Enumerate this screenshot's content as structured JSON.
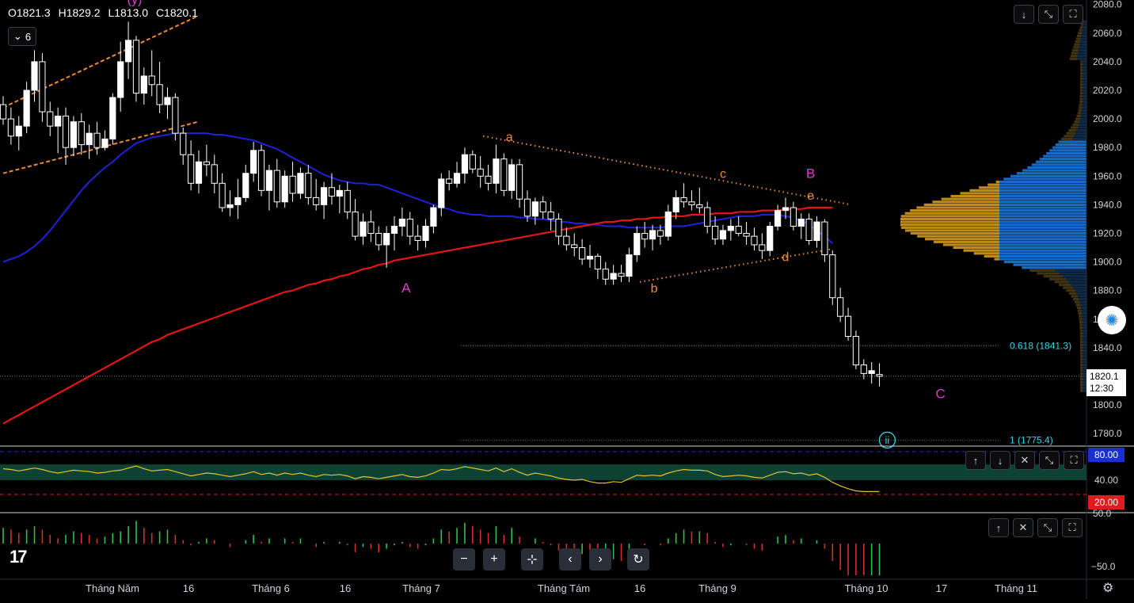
{
  "legend": {
    "open": "O1821.3",
    "high": "H1829.2",
    "low": "L1813.0",
    "close": "C1820.1",
    "indicator_count": "6"
  },
  "colors": {
    "background": "#000000",
    "candle_up": "#ffffff",
    "candle_down": "#ffffff",
    "ma_short": "#1f22d8",
    "ma_long": "#e31515",
    "channel": "#f08a35",
    "wave_orange": "#f08a35",
    "wave_magenta": "#e23bd0",
    "fib": "#39d3e8",
    "rsi_line": "#e6c229",
    "rsi_band": "#0f4a3a",
    "profile_gold": "#c8921e",
    "profile_blue": "#1a6fd0",
    "hist_green": "#2fbf4a",
    "hist_red": "#d42f2f",
    "rsi_80": "#1a2fcf",
    "rsi_20": "#e01b1b"
  },
  "price_axis": {
    "labels": [
      "2080.0",
      "2060.0",
      "2040.0",
      "2020.0",
      "2000.0",
      "1980.0",
      "1960.0",
      "1940.0",
      "1920.0",
      "1900.0",
      "1880.0",
      "1840.0",
      "1820.0",
      "1800.0",
      "1780.0"
    ],
    "partial_label": "1"
  },
  "current_price": {
    "price": "1820.1",
    "countdown": "12:30"
  },
  "fib_levels": [
    {
      "label": "0.618 (1841.3)",
      "value": 1841.3
    },
    {
      "label": "1 (1775.4)",
      "value": 1775.4
    }
  ],
  "wave_labels": [
    {
      "text": "(y)",
      "color": "#e23bd0"
    },
    {
      "text": "A",
      "color": "#e23bd0"
    },
    {
      "text": "a",
      "color": "#f08a35"
    },
    {
      "text": "b",
      "color": "#f08a35"
    },
    {
      "text": "c",
      "color": "#f08a35"
    },
    {
      "text": "d",
      "color": "#f08a35"
    },
    {
      "text": "e",
      "color": "#f08a35"
    },
    {
      "text": "B",
      "color": "#e23bd0"
    },
    {
      "text": "C",
      "color": "#e23bd0"
    },
    {
      "text": "ii",
      "color": "#39d3e8"
    }
  ],
  "rsi_axis": {
    "upper": "80.00",
    "mid": "40.00",
    "lower": "20.00"
  },
  "hist_axis": {
    "upper": "50.0",
    "lower": "−50.0"
  },
  "time_axis": [
    "Tháng Năm",
    "16",
    "Tháng 6",
    "16",
    "Tháng 7",
    "Tháng Tám",
    "16",
    "Tháng 9",
    "Tháng 10",
    "17",
    "Tháng 11"
  ],
  "chart_data": {
    "type": "candlestick",
    "title": "",
    "ylim": [
      1770,
      2082
    ],
    "rsi_levels": [
      80,
      20
    ],
    "candles": [
      {
        "o": 2010,
        "h": 2016,
        "l": 1996,
        "c": 2000
      },
      {
        "o": 2000,
        "h": 2008,
        "l": 1982,
        "c": 1988
      },
      {
        "o": 1988,
        "h": 2002,
        "l": 1978,
        "c": 1995
      },
      {
        "o": 1995,
        "h": 2026,
        "l": 1990,
        "c": 2020
      },
      {
        "o": 2020,
        "h": 2048,
        "l": 2012,
        "c": 2040
      },
      {
        "o": 2040,
        "h": 2046,
        "l": 1998,
        "c": 2005
      },
      {
        "o": 2005,
        "h": 2012,
        "l": 1988,
        "c": 1995
      },
      {
        "o": 1995,
        "h": 2008,
        "l": 1976,
        "c": 2002
      },
      {
        "o": 2002,
        "h": 2008,
        "l": 1968,
        "c": 1980
      },
      {
        "o": 1980,
        "h": 2002,
        "l": 1974,
        "c": 1998
      },
      {
        "o": 1998,
        "h": 2004,
        "l": 1975,
        "c": 1982
      },
      {
        "o": 1982,
        "h": 1996,
        "l": 1972,
        "c": 1990
      },
      {
        "o": 1990,
        "h": 1998,
        "l": 1975,
        "c": 1980
      },
      {
        "o": 1980,
        "h": 1992,
        "l": 1978,
        "c": 1986
      },
      {
        "o": 1986,
        "h": 2018,
        "l": 1982,
        "c": 2015
      },
      {
        "o": 2015,
        "h": 2054,
        "l": 2005,
        "c": 2040
      },
      {
        "o": 2040,
        "h": 2068,
        "l": 2028,
        "c": 2055
      },
      {
        "o": 2055,
        "h": 2058,
        "l": 2012,
        "c": 2018
      },
      {
        "o": 2018,
        "h": 2036,
        "l": 2010,
        "c": 2030
      },
      {
        "o": 2030,
        "h": 2048,
        "l": 2016,
        "c": 2024
      },
      {
        "o": 2024,
        "h": 2040,
        "l": 2004,
        "c": 2010
      },
      {
        "o": 2010,
        "h": 2022,
        "l": 2000,
        "c": 2015
      },
      {
        "o": 2015,
        "h": 2018,
        "l": 1985,
        "c": 1990
      },
      {
        "o": 1990,
        "h": 1994,
        "l": 1968,
        "c": 1975
      },
      {
        "o": 1975,
        "h": 1985,
        "l": 1950,
        "c": 1955
      },
      {
        "o": 1955,
        "h": 1978,
        "l": 1948,
        "c": 1970
      },
      {
        "o": 1970,
        "h": 1982,
        "l": 1960,
        "c": 1968
      },
      {
        "o": 1968,
        "h": 1975,
        "l": 1948,
        "c": 1955
      },
      {
        "o": 1955,
        "h": 1962,
        "l": 1935,
        "c": 1938
      },
      {
        "o": 1938,
        "h": 1950,
        "l": 1932,
        "c": 1940
      },
      {
        "o": 1940,
        "h": 1958,
        "l": 1930,
        "c": 1945
      },
      {
        "o": 1945,
        "h": 1968,
        "l": 1942,
        "c": 1962
      },
      {
        "o": 1962,
        "h": 1984,
        "l": 1956,
        "c": 1978
      },
      {
        "o": 1978,
        "h": 1982,
        "l": 1946,
        "c": 1950
      },
      {
        "o": 1950,
        "h": 1968,
        "l": 1936,
        "c": 1964
      },
      {
        "o": 1964,
        "h": 1972,
        "l": 1938,
        "c": 1942
      },
      {
        "o": 1942,
        "h": 1964,
        "l": 1938,
        "c": 1960
      },
      {
        "o": 1960,
        "h": 1970,
        "l": 1942,
        "c": 1948
      },
      {
        "o": 1948,
        "h": 1966,
        "l": 1944,
        "c": 1962
      },
      {
        "o": 1962,
        "h": 1968,
        "l": 1940,
        "c": 1945
      },
      {
        "o": 1945,
        "h": 1958,
        "l": 1936,
        "c": 1940
      },
      {
        "o": 1940,
        "h": 1956,
        "l": 1930,
        "c": 1952
      },
      {
        "o": 1952,
        "h": 1962,
        "l": 1940,
        "c": 1946
      },
      {
        "o": 1946,
        "h": 1954,
        "l": 1934,
        "c": 1950
      },
      {
        "o": 1950,
        "h": 1956,
        "l": 1930,
        "c": 1935
      },
      {
        "o": 1935,
        "h": 1944,
        "l": 1915,
        "c": 1918
      },
      {
        "o": 1918,
        "h": 1934,
        "l": 1912,
        "c": 1928
      },
      {
        "o": 1928,
        "h": 1936,
        "l": 1914,
        "c": 1920
      },
      {
        "o": 1920,
        "h": 1925,
        "l": 1908,
        "c": 1912
      },
      {
        "o": 1912,
        "h": 1925,
        "l": 1896,
        "c": 1920
      },
      {
        "o": 1920,
        "h": 1932,
        "l": 1908,
        "c": 1925
      },
      {
        "o": 1925,
        "h": 1938,
        "l": 1918,
        "c": 1930
      },
      {
        "o": 1930,
        "h": 1935,
        "l": 1912,
        "c": 1918
      },
      {
        "o": 1918,
        "h": 1926,
        "l": 1908,
        "c": 1915
      },
      {
        "o": 1915,
        "h": 1930,
        "l": 1910,
        "c": 1925
      },
      {
        "o": 1925,
        "h": 1940,
        "l": 1920,
        "c": 1938
      },
      {
        "o": 1938,
        "h": 1962,
        "l": 1932,
        "c": 1958
      },
      {
        "o": 1958,
        "h": 1964,
        "l": 1950,
        "c": 1955
      },
      {
        "o": 1955,
        "h": 1970,
        "l": 1952,
        "c": 1962
      },
      {
        "o": 1962,
        "h": 1980,
        "l": 1955,
        "c": 1975
      },
      {
        "o": 1975,
        "h": 1978,
        "l": 1962,
        "c": 1965
      },
      {
        "o": 1965,
        "h": 1974,
        "l": 1952,
        "c": 1960
      },
      {
        "o": 1960,
        "h": 1968,
        "l": 1950,
        "c": 1955
      },
      {
        "o": 1955,
        "h": 1982,
        "l": 1948,
        "c": 1972
      },
      {
        "o": 1972,
        "h": 1976,
        "l": 1946,
        "c": 1950
      },
      {
        "o": 1950,
        "h": 1972,
        "l": 1944,
        "c": 1968
      },
      {
        "o": 1968,
        "h": 1972,
        "l": 1938,
        "c": 1944
      },
      {
        "o": 1944,
        "h": 1950,
        "l": 1928,
        "c": 1932
      },
      {
        "o": 1932,
        "h": 1945,
        "l": 1926,
        "c": 1942
      },
      {
        "o": 1942,
        "h": 1946,
        "l": 1930,
        "c": 1935
      },
      {
        "o": 1935,
        "h": 1942,
        "l": 1922,
        "c": 1930
      },
      {
        "o": 1930,
        "h": 1934,
        "l": 1912,
        "c": 1918
      },
      {
        "o": 1918,
        "h": 1924,
        "l": 1908,
        "c": 1912
      },
      {
        "o": 1912,
        "h": 1920,
        "l": 1904,
        "c": 1910
      },
      {
        "o": 1910,
        "h": 1916,
        "l": 1898,
        "c": 1902
      },
      {
        "o": 1902,
        "h": 1912,
        "l": 1896,
        "c": 1904
      },
      {
        "o": 1904,
        "h": 1906,
        "l": 1888,
        "c": 1895
      },
      {
        "o": 1895,
        "h": 1900,
        "l": 1884,
        "c": 1888
      },
      {
        "o": 1888,
        "h": 1898,
        "l": 1884,
        "c": 1892
      },
      {
        "o": 1892,
        "h": 1898,
        "l": 1886,
        "c": 1890
      },
      {
        "o": 1890,
        "h": 1910,
        "l": 1886,
        "c": 1905
      },
      {
        "o": 1905,
        "h": 1925,
        "l": 1900,
        "c": 1920
      },
      {
        "o": 1920,
        "h": 1928,
        "l": 1910,
        "c": 1916
      },
      {
        "o": 1916,
        "h": 1926,
        "l": 1908,
        "c": 1922
      },
      {
        "o": 1922,
        "h": 1926,
        "l": 1912,
        "c": 1918
      },
      {
        "o": 1918,
        "h": 1940,
        "l": 1915,
        "c": 1935
      },
      {
        "o": 1935,
        "h": 1950,
        "l": 1930,
        "c": 1945
      },
      {
        "o": 1945,
        "h": 1955,
        "l": 1938,
        "c": 1942
      },
      {
        "o": 1942,
        "h": 1950,
        "l": 1936,
        "c": 1940
      },
      {
        "o": 1940,
        "h": 1952,
        "l": 1934,
        "c": 1938
      },
      {
        "o": 1938,
        "h": 1942,
        "l": 1920,
        "c": 1925
      },
      {
        "o": 1925,
        "h": 1932,
        "l": 1912,
        "c": 1916
      },
      {
        "o": 1916,
        "h": 1926,
        "l": 1912,
        "c": 1922
      },
      {
        "o": 1922,
        "h": 1930,
        "l": 1915,
        "c": 1925
      },
      {
        "o": 1925,
        "h": 1932,
        "l": 1918,
        "c": 1920
      },
      {
        "o": 1920,
        "h": 1928,
        "l": 1912,
        "c": 1918
      },
      {
        "o": 1918,
        "h": 1924,
        "l": 1908,
        "c": 1912
      },
      {
        "o": 1912,
        "h": 1920,
        "l": 1902,
        "c": 1908
      },
      {
        "o": 1908,
        "h": 1928,
        "l": 1904,
        "c": 1925
      },
      {
        "o": 1925,
        "h": 1940,
        "l": 1922,
        "c": 1936
      },
      {
        "o": 1936,
        "h": 1945,
        "l": 1930,
        "c": 1938
      },
      {
        "o": 1938,
        "h": 1942,
        "l": 1922,
        "c": 1925
      },
      {
        "o": 1925,
        "h": 1934,
        "l": 1916,
        "c": 1930
      },
      {
        "o": 1930,
        "h": 1934,
        "l": 1912,
        "c": 1915
      },
      {
        "o": 1915,
        "h": 1932,
        "l": 1910,
        "c": 1928
      },
      {
        "o": 1928,
        "h": 1930,
        "l": 1900,
        "c": 1905
      },
      {
        "o": 1905,
        "h": 1908,
        "l": 1870,
        "c": 1875
      },
      {
        "o": 1875,
        "h": 1882,
        "l": 1858,
        "c": 1862
      },
      {
        "o": 1862,
        "h": 1868,
        "l": 1845,
        "c": 1848
      },
      {
        "o": 1848,
        "h": 1852,
        "l": 1825,
        "c": 1828
      },
      {
        "o": 1828,
        "h": 1832,
        "l": 1818,
        "c": 1822
      },
      {
        "o": 1822,
        "h": 1830,
        "l": 1815,
        "c": 1824
      },
      {
        "o": 1821.3,
        "h": 1829.2,
        "l": 1813.0,
        "c": 1820.1
      }
    ],
    "ma_short": [
      1900,
      1902,
      1904,
      1907,
      1911,
      1916,
      1922,
      1929,
      1936,
      1943,
      1950,
      1956,
      1961,
      1966,
      1970,
      1975,
      1979,
      1983,
      1985,
      1987,
      1988,
      1989,
      1990,
      1990,
      1990,
      1990,
      1990,
      1989,
      1989,
      1988,
      1987,
      1986,
      1985,
      1983,
      1981,
      1979,
      1976,
      1973,
      1970,
      1967,
      1964,
      1961,
      1959,
      1957,
      1956,
      1955,
      1955,
      1954,
      1954,
      1952,
      1950,
      1948,
      1946,
      1944,
      1942,
      1940,
      1938,
      1937,
      1935,
      1934,
      1933,
      1933,
      1932,
      1932,
      1932,
      1932,
      1931,
      1931,
      1930,
      1930,
      1929,
      1928,
      1928,
      1927,
      1927,
      1926,
      1926,
      1925,
      1925,
      1925,
      1924,
      1924,
      1924,
      1924,
      1924,
      1925,
      1925,
      1925,
      1926,
      1927,
      1928,
      1929,
      1930,
      1931,
      1932,
      1932,
      1932,
      1933,
      1933,
      1933,
      1932,
      1931,
      1929,
      1926,
      1922,
      1918,
      1913
    ],
    "ma_long": [
      1787,
      1790,
      1793,
      1796,
      1799,
      1802,
      1805,
      1808,
      1811,
      1814,
      1817,
      1820,
      1823,
      1826,
      1829,
      1832,
      1835,
      1838,
      1841,
      1844,
      1846,
      1849,
      1851,
      1853,
      1855,
      1857,
      1859,
      1861,
      1863,
      1865,
      1867,
      1869,
      1871,
      1873,
      1875,
      1877,
      1879,
      1880,
      1882,
      1884,
      1885,
      1887,
      1888,
      1890,
      1891,
      1893,
      1895,
      1896,
      1898,
      1899,
      1901,
      1902,
      1903,
      1904,
      1905,
      1906,
      1907,
      1908,
      1909,
      1910,
      1911,
      1912,
      1913,
      1914,
      1915,
      1916,
      1917,
      1918,
      1919,
      1920,
      1921,
      1922,
      1923,
      1924,
      1925,
      1926,
      1927,
      1928,
      1928,
      1929,
      1929,
      1930,
      1930,
      1931,
      1931,
      1932,
      1932,
      1932,
      1933,
      1933,
      1933,
      1934,
      1934,
      1934,
      1935,
      1935,
      1935,
      1936,
      1936,
      1936,
      1937,
      1937,
      1937,
      1938,
      1938,
      1938,
      1938
    ],
    "rsi": [
      56,
      55,
      53,
      55,
      57,
      55,
      52,
      50,
      52,
      54,
      53,
      52,
      50,
      51,
      53,
      54,
      57,
      60,
      56,
      53,
      54,
      55,
      52,
      49,
      46,
      48,
      50,
      49,
      47,
      45,
      47,
      49,
      52,
      48,
      50,
      47,
      50,
      48,
      50,
      47,
      45,
      48,
      47,
      48,
      46,
      42,
      45,
      44,
      42,
      44,
      46,
      48,
      45,
      44,
      46,
      50,
      55,
      54,
      56,
      59,
      57,
      55,
      53,
      57,
      52,
      56,
      51,
      47,
      50,
      48,
      46,
      43,
      41,
      40,
      41,
      38,
      36,
      36,
      38,
      37,
      42,
      47,
      46,
      47,
      46,
      50,
      53,
      55,
      54,
      54,
      53,
      48,
      45,
      46,
      47,
      46,
      44,
      43,
      47,
      51,
      52,
      49,
      50,
      47,
      49,
      44,
      37,
      32,
      28,
      25,
      24,
      24,
      24
    ]
  }
}
